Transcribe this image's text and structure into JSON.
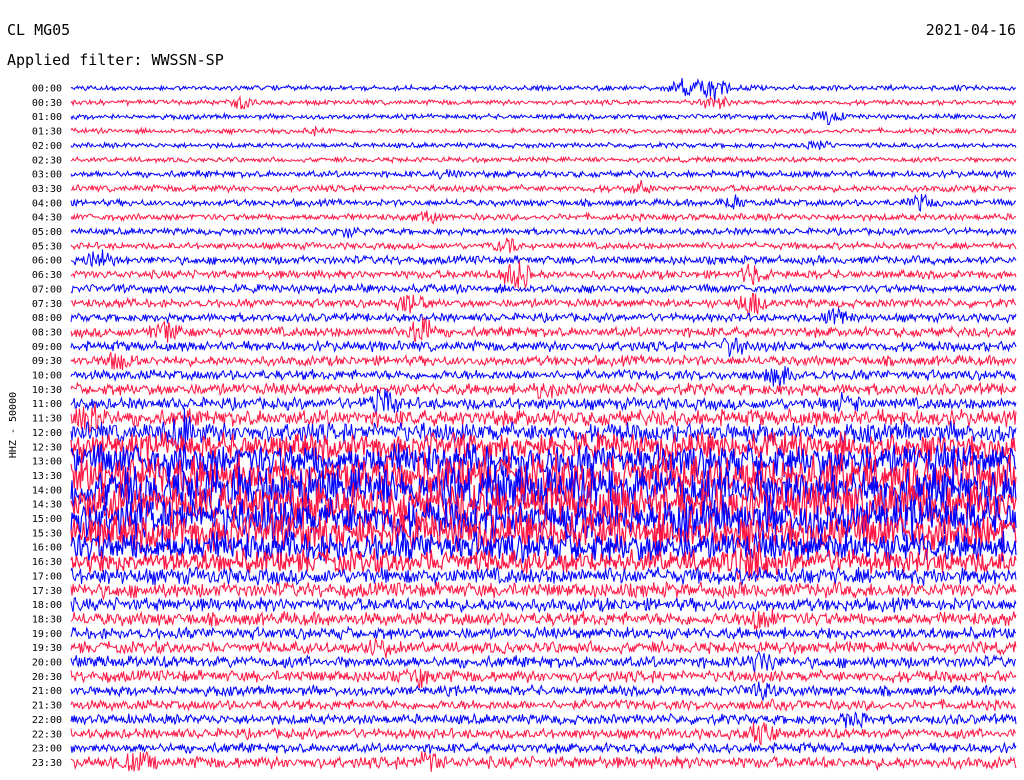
{
  "header": {
    "station": "CL MG05",
    "date": "2021-04-16",
    "filter": "Applied filter: WWSSN-SP"
  },
  "chart_data": {
    "type": "line",
    "title": "CL MG05",
    "ylabel": "HHZ - 50000",
    "colors": [
      "#0000ff",
      "#ff1744"
    ],
    "traces": [
      {
        "label": "00:00",
        "color": "#0000ff",
        "amplitude": 3,
        "events": [
          [
            0.65,
            12
          ],
          [
            0.68,
            16
          ]
        ]
      },
      {
        "label": "00:30",
        "color": "#ff1744",
        "amplitude": 3,
        "events": [
          [
            0.18,
            8
          ],
          [
            0.68,
            9
          ]
        ]
      },
      {
        "label": "01:00",
        "color": "#0000ff",
        "amplitude": 3,
        "events": [
          [
            0.8,
            10
          ]
        ]
      },
      {
        "label": "01:30",
        "color": "#ff1744",
        "amplitude": 3,
        "events": [
          [
            0.26,
            4
          ]
        ]
      },
      {
        "label": "02:00",
        "color": "#0000ff",
        "amplitude": 3,
        "events": [
          [
            0.79,
            5
          ]
        ]
      },
      {
        "label": "02:30",
        "color": "#ff1744",
        "amplitude": 3,
        "events": []
      },
      {
        "label": "03:00",
        "color": "#0000ff",
        "amplitude": 4,
        "events": [
          [
            0.4,
            5
          ]
        ]
      },
      {
        "label": "03:30",
        "color": "#ff1744",
        "amplitude": 4,
        "events": [
          [
            0.6,
            6
          ]
        ]
      },
      {
        "label": "04:00",
        "color": "#0000ff",
        "amplitude": 4,
        "events": [
          [
            0.7,
            8
          ],
          [
            0.9,
            8
          ]
        ]
      },
      {
        "label": "04:30",
        "color": "#ff1744",
        "amplitude": 4,
        "events": [
          [
            0.38,
            5
          ]
        ]
      },
      {
        "label": "05:00",
        "color": "#0000ff",
        "amplitude": 4,
        "events": [
          [
            0.29,
            5
          ]
        ]
      },
      {
        "label": "05:30",
        "color": "#ff1744",
        "amplitude": 4,
        "events": [
          [
            0.46,
            8
          ]
        ]
      },
      {
        "label": "06:00",
        "color": "#0000ff",
        "amplitude": 5,
        "events": [
          [
            0.03,
            10
          ]
        ]
      },
      {
        "label": "06:30",
        "color": "#ff1744",
        "amplitude": 5,
        "events": [
          [
            0.47,
            22
          ],
          [
            0.72,
            10
          ]
        ]
      },
      {
        "label": "07:00",
        "color": "#0000ff",
        "amplitude": 5,
        "events": []
      },
      {
        "label": "07:30",
        "color": "#ff1744",
        "amplitude": 5,
        "events": [
          [
            0.72,
            14
          ],
          [
            0.36,
            12
          ]
        ]
      },
      {
        "label": "08:00",
        "color": "#0000ff",
        "amplitude": 5,
        "events": [
          [
            0.81,
            10
          ]
        ]
      },
      {
        "label": "08:30",
        "color": "#ff1744",
        "amplitude": 6,
        "events": [
          [
            0.37,
            18
          ],
          [
            0.1,
            10
          ]
        ]
      },
      {
        "label": "09:00",
        "color": "#0000ff",
        "amplitude": 6,
        "events": [
          [
            0.7,
            10
          ]
        ]
      },
      {
        "label": "09:30",
        "color": "#ff1744",
        "amplitude": 6,
        "events": [
          [
            0.05,
            10
          ]
        ]
      },
      {
        "label": "10:00",
        "color": "#0000ff",
        "amplitude": 6,
        "events": [
          [
            0.75,
            12
          ]
        ]
      },
      {
        "label": "10:30",
        "color": "#ff1744",
        "amplitude": 7,
        "events": [
          [
            0.5,
            8
          ]
        ]
      },
      {
        "label": "11:00",
        "color": "#0000ff",
        "amplitude": 7,
        "events": [
          [
            0.33,
            16
          ],
          [
            0.82,
            12
          ]
        ]
      },
      {
        "label": "11:30",
        "color": "#ff1744",
        "amplitude": 10,
        "events": [
          [
            0.02,
            20
          ]
        ]
      },
      {
        "label": "12:00",
        "color": "#0000ff",
        "amplitude": 12,
        "events": [
          [
            0.12,
            18
          ]
        ]
      },
      {
        "label": "12:30",
        "color": "#ff1744",
        "amplitude": 16,
        "events": []
      },
      {
        "label": "13:00",
        "color": "#0000ff",
        "amplitude": 20,
        "events": []
      },
      {
        "label": "13:30",
        "color": "#ff1744",
        "amplitude": 24,
        "events": []
      },
      {
        "label": "14:00",
        "color": "#0000ff",
        "amplitude": 26,
        "events": []
      },
      {
        "label": "14:30",
        "color": "#ff1744",
        "amplitude": 26,
        "events": []
      },
      {
        "label": "15:00",
        "color": "#0000ff",
        "amplitude": 24,
        "events": []
      },
      {
        "label": "15:30",
        "color": "#ff1744",
        "amplitude": 22,
        "events": []
      },
      {
        "label": "16:00",
        "color": "#0000ff",
        "amplitude": 18,
        "events": []
      },
      {
        "label": "16:30",
        "color": "#ff1744",
        "amplitude": 14,
        "events": [
          [
            0.72,
            20
          ]
        ]
      },
      {
        "label": "17:00",
        "color": "#0000ff",
        "amplitude": 10,
        "events": []
      },
      {
        "label": "17:30",
        "color": "#ff1744",
        "amplitude": 9,
        "events": []
      },
      {
        "label": "18:00",
        "color": "#0000ff",
        "amplitude": 8,
        "events": []
      },
      {
        "label": "18:30",
        "color": "#ff1744",
        "amplitude": 8,
        "events": [
          [
            0.73,
            12
          ]
        ]
      },
      {
        "label": "19:00",
        "color": "#0000ff",
        "amplitude": 7,
        "events": []
      },
      {
        "label": "19:30",
        "color": "#ff1744",
        "amplitude": 7,
        "events": [
          [
            0.33,
            8
          ]
        ]
      },
      {
        "label": "20:00",
        "color": "#0000ff",
        "amplitude": 7,
        "events": [
          [
            0.73,
            10
          ]
        ]
      },
      {
        "label": "20:30",
        "color": "#ff1744",
        "amplitude": 7,
        "events": [
          [
            0.37,
            8
          ]
        ]
      },
      {
        "label": "21:00",
        "color": "#0000ff",
        "amplitude": 6,
        "events": [
          [
            0.73,
            10
          ]
        ]
      },
      {
        "label": "21:30",
        "color": "#ff1744",
        "amplitude": 6,
        "events": []
      },
      {
        "label": "22:00",
        "color": "#0000ff",
        "amplitude": 6,
        "events": [
          [
            0.83,
            8
          ]
        ]
      },
      {
        "label": "22:30",
        "color": "#ff1744",
        "amplitude": 6,
        "events": [
          [
            0.73,
            10
          ]
        ]
      },
      {
        "label": "23:00",
        "color": "#0000ff",
        "amplitude": 6,
        "events": []
      },
      {
        "label": "23:30",
        "color": "#ff1744",
        "amplitude": 7,
        "events": [
          [
            0.07,
            10
          ],
          [
            0.38,
            12
          ]
        ]
      }
    ]
  }
}
